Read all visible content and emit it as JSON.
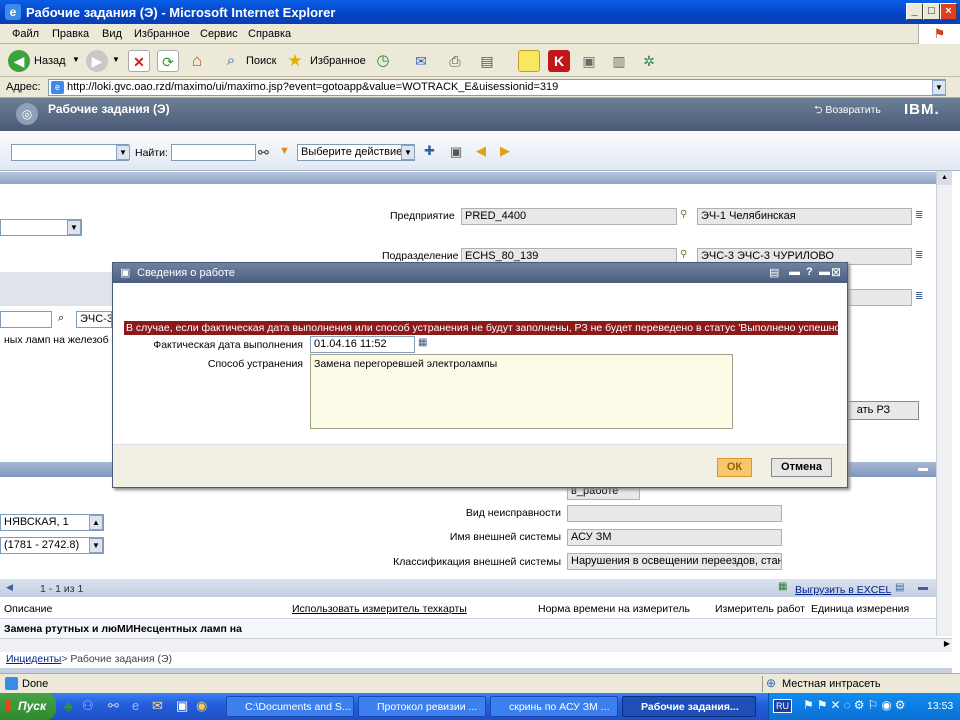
{
  "window": {
    "title": "Рабочие задания (Э) - Microsoft Internet Explorer"
  },
  "menu": [
    "Файл",
    "Правка",
    "Вид",
    "Избранное",
    "Сервис",
    "Справка"
  ],
  "toolbar": {
    "back": "Назад",
    "search": "Поиск",
    "favorites": "Избранное"
  },
  "address": {
    "label": "Адрес:",
    "url": "http://loki.gvc.oao.rzd/maximo/ui/maximo.jsp?event=gotoapp&value=WOTRACK_E&uisessionid=319"
  },
  "app": {
    "title": "Рабочие задания (Э)",
    "return": "Возвратить",
    "brand": "IBM."
  },
  "findbar": {
    "find_label": "Найти:",
    "action_select": "Выберите действие"
  },
  "form": {
    "enterprise_label": "Предприятие",
    "enterprise_code": "PRED_4400",
    "enterprise_name": "ЭЧ-1 Челябинская",
    "division_label": "Подразделение",
    "division_code": "ECHS_80_139",
    "division_name": "ЭЧС-3 ЭЧС-3 ЧУРИЛОВО",
    "left_input": "ЭЧС-3",
    "left_desc": "ных ламп на железоб",
    "create_button": "ать РЗ",
    "status_value": "в_работе",
    "address_text": "НЯВСКАЯ, 1",
    "coords_text": "(1781 - 2742.8)",
    "fault_type_label": "Вид неисправности",
    "fault_type_value": "",
    "ext_system_label": "Имя внешней системы",
    "ext_system_value": "АСУ ЗМ",
    "ext_class_label": "Классификация внешней системы",
    "ext_class_value": "Нарушения в освещении переездов, станци"
  },
  "table": {
    "pager": "1 - 1 из 1",
    "export": "Выгрузить в EXCEL",
    "columns": [
      "Описание",
      "Использовать измеритель техкарты",
      "Норма времени на измеритель",
      "Измеритель работ",
      "Единица измерения"
    ],
    "row": "Замена ртутных и люМИНесцентных ламп на"
  },
  "breadcrumb": {
    "link": "Инциденты",
    "current": "> Рабочие задания (Э)"
  },
  "dialog": {
    "title": "Сведения о работе",
    "message": "В случае, если фактическая дата выполнения или способ устранения не будут заполнены, РЗ не будет переведено в статус 'Выполнено успешно'",
    "actual_date_label": "Фактическая дата выполнения",
    "actual_date_value": "01.04.16 11:52",
    "method_label": "Способ устранения",
    "method_value": "Замена перегоревшей электролампы",
    "ok": "ОК",
    "cancel": "Отмена"
  },
  "status": {
    "left": "Done",
    "zone": "Местная интрасеть"
  },
  "taskbar": {
    "start": "Пуск",
    "tasks": [
      "C:\\Documents and S...",
      "Протокол ревизии ...",
      "скринь по АСУ ЗМ ...",
      "Рабочие задания..."
    ],
    "lang": "RU",
    "clock": "13:53"
  },
  "colors": {
    "message_bg": "#8b1a1a",
    "ok_bg": "#f7c86a",
    "title_blue": "#0344c8"
  }
}
